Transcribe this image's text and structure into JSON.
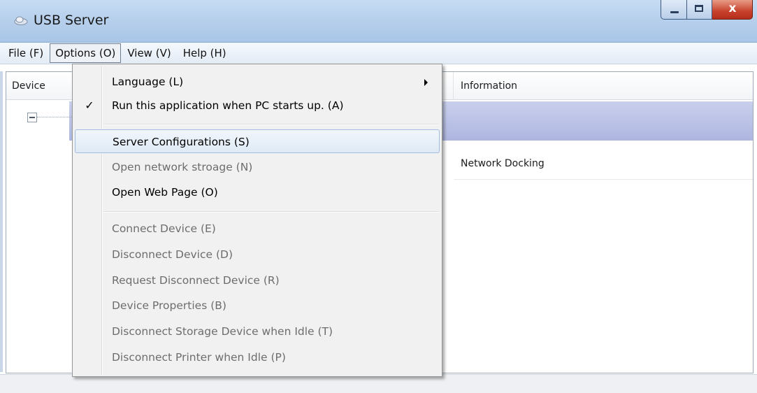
{
  "window": {
    "title": "USB Server"
  },
  "menubar": {
    "items": [
      {
        "label": "File (F)"
      },
      {
        "label": "Options (O)"
      },
      {
        "label": "View (V)"
      },
      {
        "label": "Help (H)"
      }
    ]
  },
  "table": {
    "headers": {
      "device": "Device",
      "information": "Information"
    },
    "rows": [
      {
        "information": ""
      },
      {
        "information": "Network Docking"
      }
    ]
  },
  "options_menu": {
    "items": [
      {
        "label": "Language (L)",
        "enabled": true,
        "submenu": true
      },
      {
        "label": "Run this application when PC starts up. (A)",
        "enabled": true,
        "checked": true,
        "check_glyph": "✓"
      },
      {
        "label": "Server Configurations (S)",
        "enabled": true,
        "highlighted": true
      },
      {
        "label": "Open network stroage (N)",
        "enabled": false
      },
      {
        "label": "Open Web Page (O)",
        "enabled": true
      },
      {
        "label": "Connect Device (E)",
        "enabled": false
      },
      {
        "label": "Disconnect Device (D)",
        "enabled": false
      },
      {
        "label": "Request Disconnect Device (R)",
        "enabled": false
      },
      {
        "label": "Device Properties (B)",
        "enabled": false
      },
      {
        "label": "Disconnect Storage Device when Idle (T)",
        "enabled": false
      },
      {
        "label": "Disconnect Printer when Idle (P)",
        "enabled": false
      }
    ]
  },
  "colors": {
    "selection": "#b4bce2",
    "menu_highlight_border": "#9fbbe0",
    "disabled_text": "#6d6d6d",
    "close_button": "#c7412c"
  },
  "icons": {
    "app": "cloud-drive-icon",
    "minimize": "minimize-icon",
    "maximize": "maximize-icon",
    "close": "close-icon"
  }
}
